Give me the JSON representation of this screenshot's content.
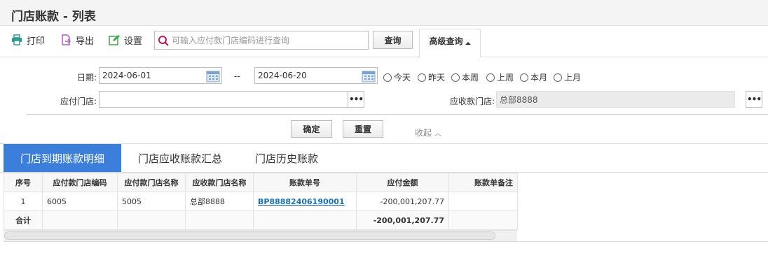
{
  "page": {
    "title": "门店账款 - 列表"
  },
  "toolbar": {
    "print_label": "打印",
    "export_label": "导出",
    "settings_label": "设置",
    "search_placeholder": "可输入应付款门店编码进行查询",
    "query_label": "查询",
    "advanced_label": "高级查询"
  },
  "filters": {
    "date_label": "日期:",
    "date_from": "2024-06-01",
    "date_sep": "--",
    "date_to": "2024-06-20",
    "quick_ranges": [
      "今天",
      "昨天",
      "本周",
      "上周",
      "本月",
      "上月"
    ],
    "payer_store_label": "应付门店:",
    "payer_store_value": "",
    "payee_store_label": "应收款门店:",
    "payee_store_value": "总部8888",
    "confirm_label": "确定",
    "reset_label": "重置",
    "collapse_label": "收起"
  },
  "tabs": [
    {
      "label": "门店到期账款明细",
      "active": true
    },
    {
      "label": "门店应收账款汇总",
      "active": false
    },
    {
      "label": "门店历史账款",
      "active": false
    }
  ],
  "grid": {
    "columns": [
      "序号",
      "应付款门店编码",
      "应付款门店名称",
      "应收款门店名称",
      "账款单号",
      "应付金额",
      "账款单备注"
    ],
    "rows": [
      {
        "index": "1",
        "payer_code": "6005",
        "payer_name": "5005",
        "payee_name": "总部8888",
        "bill_no": "BP88882406190001",
        "amount": "-200,001,207.77",
        "remark": ""
      }
    ],
    "total": {
      "label": "合计",
      "amount": "-200,001,207.77"
    }
  },
  "colors": {
    "accent": "#3b7fdb",
    "link": "#1a6fb8"
  }
}
